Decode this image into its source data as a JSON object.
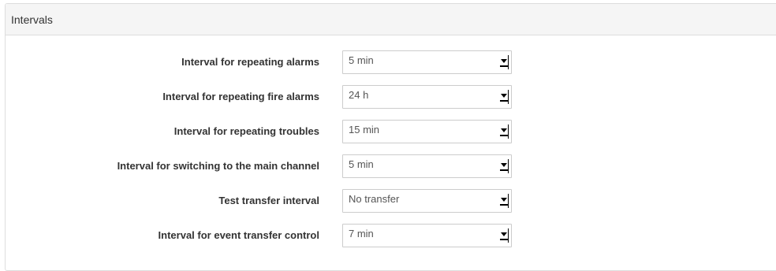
{
  "panel": {
    "title": "Intervals"
  },
  "fields": [
    {
      "label": "Interval for repeating alarms",
      "value": "5 min"
    },
    {
      "label": "Interval for repeating fire alarms",
      "value": "24 h"
    },
    {
      "label": "Interval for repeating troubles",
      "value": "15 min"
    },
    {
      "label": "Interval for switching to the main channel",
      "value": "5 min"
    },
    {
      "label": "Test transfer interval",
      "value": "No transfer"
    },
    {
      "label": "Interval for event transfer control",
      "value": "7 min"
    }
  ],
  "icons": {
    "dropdown": "dropdown-arrow-icon"
  },
  "colors": {
    "heading_bg": "#f5f5f5",
    "border": "#dddddd",
    "label_text": "#333333",
    "value_text": "#555555"
  }
}
